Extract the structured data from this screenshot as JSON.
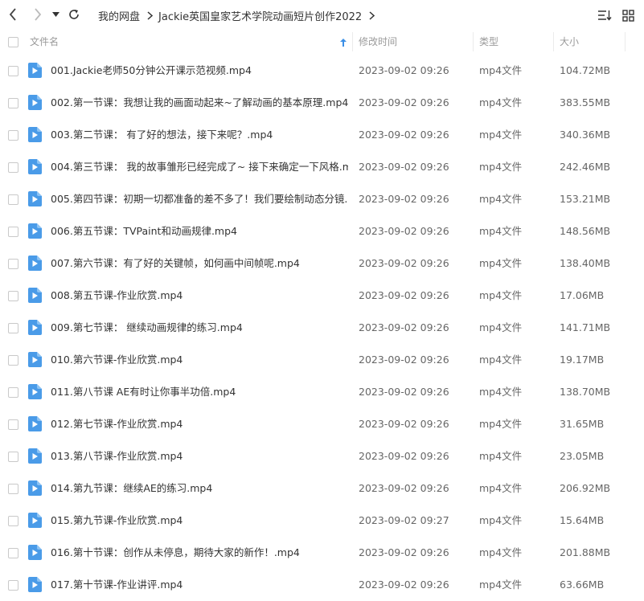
{
  "breadcrumb": [
    "我的网盘",
    "Jackie英国皇家艺术学院动画短片创作2022"
  ],
  "columns": {
    "name": "文件名",
    "modified": "修改时间",
    "type": "类型",
    "size": "大小"
  },
  "colors": {
    "accent": "#3b8fe6",
    "file_icon": "#4a9be8"
  },
  "icons": {
    "back": "arrow-left-icon",
    "forward": "arrow-right-icon",
    "history": "caret-down-icon",
    "refresh": "refresh-icon",
    "sort": "sort-icon",
    "grid": "grid-view-icon",
    "file": "video-file-icon"
  },
  "files": [
    {
      "name": "001.Jackie老师50分钟公开课示范视频.mp4",
      "modified": "2023-09-02 09:26",
      "type": "mp4文件",
      "size": "104.72MB"
    },
    {
      "name": "002.第一节课：我想让我的画面动起来~了解动画的基本原理.mp4",
      "modified": "2023-09-02 09:26",
      "type": "mp4文件",
      "size": "383.55MB"
    },
    {
      "name": "003.第二节课： 有了好的想法，接下来呢？.mp4",
      "modified": "2023-09-02 09:26",
      "type": "mp4文件",
      "size": "340.36MB"
    },
    {
      "name": "004.第三节课： 我的故事雏形已经完成了~ 接下来确定一下风格.m...",
      "modified": "2023-09-02 09:26",
      "type": "mp4文件",
      "size": "242.46MB"
    },
    {
      "name": "005.第四节课：初期一切都准备的差不多了！我们要绘制动态分镜...",
      "modified": "2023-09-02 09:26",
      "type": "mp4文件",
      "size": "153.21MB"
    },
    {
      "name": "006.第五节课：TVPaint和动画规律.mp4",
      "modified": "2023-09-02 09:26",
      "type": "mp4文件",
      "size": "148.56MB"
    },
    {
      "name": "007.第六节课：有了好的关键帧，如何画中间帧呢.mp4",
      "modified": "2023-09-02 09:26",
      "type": "mp4文件",
      "size": "138.40MB"
    },
    {
      "name": "008.第五节课-作业欣赏.mp4",
      "modified": "2023-09-02 09:26",
      "type": "mp4文件",
      "size": "17.06MB"
    },
    {
      "name": "009.第七节课： 继续动画规律的练习.mp4",
      "modified": "2023-09-02 09:26",
      "type": "mp4文件",
      "size": "141.71MB"
    },
    {
      "name": "010.第六节课-作业欣赏.mp4",
      "modified": "2023-09-02 09:26",
      "type": "mp4文件",
      "size": "19.17MB"
    },
    {
      "name": "011.第八节课 AE有时让你事半功倍.mp4",
      "modified": "2023-09-02 09:26",
      "type": "mp4文件",
      "size": "138.70MB"
    },
    {
      "name": "012.第七节课-作业欣赏.mp4",
      "modified": "2023-09-02 09:26",
      "type": "mp4文件",
      "size": "31.65MB"
    },
    {
      "name": "013.第八节课-作业欣赏.mp4",
      "modified": "2023-09-02 09:26",
      "type": "mp4文件",
      "size": "23.05MB"
    },
    {
      "name": "014.第九节课：继续AE的练习.mp4",
      "modified": "2023-09-02 09:26",
      "type": "mp4文件",
      "size": "206.92MB"
    },
    {
      "name": "015.第九节课-作业欣赏.mp4",
      "modified": "2023-09-02 09:27",
      "type": "mp4文件",
      "size": "15.64MB"
    },
    {
      "name": "016.第十节课：创作从未停息，期待大家的新作！.mp4",
      "modified": "2023-09-02 09:26",
      "type": "mp4文件",
      "size": "201.88MB"
    },
    {
      "name": "017.第十节课-作业讲评.mp4",
      "modified": "2023-09-02 09:26",
      "type": "mp4文件",
      "size": "63.66MB"
    }
  ]
}
